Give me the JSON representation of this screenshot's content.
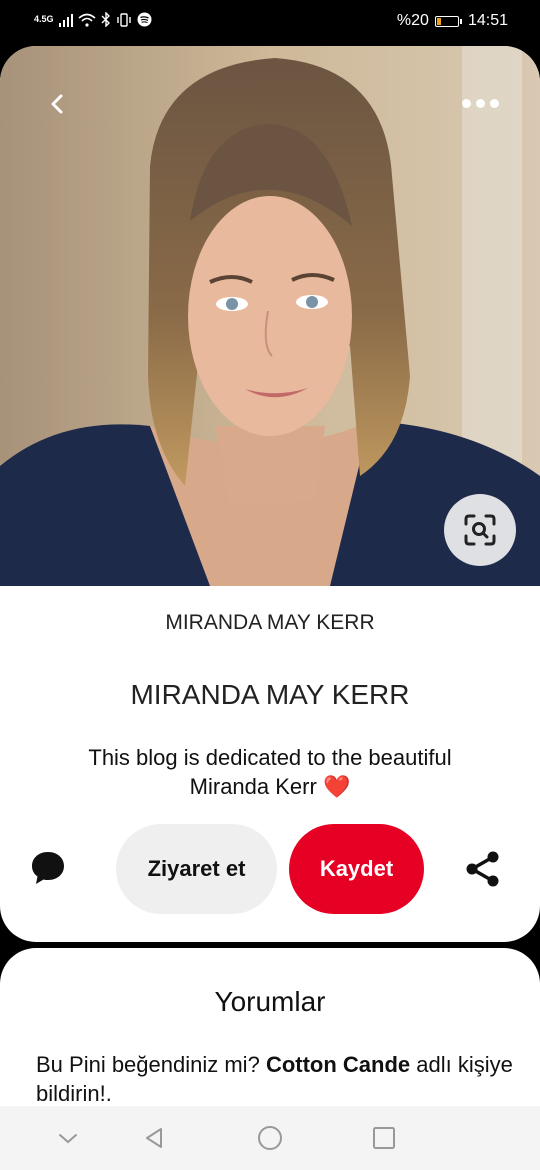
{
  "status_bar": {
    "network_label": "4.5G",
    "battery_text": "%20",
    "battery_level": 0.2,
    "time": "14:51",
    "icons": [
      "signal-icon",
      "wifi-icon",
      "bluetooth-icon",
      "vibrate-icon",
      "spotify-icon",
      "battery-icon"
    ]
  },
  "pin": {
    "image_subject": "photo-of-woman",
    "back_icon": "back-icon",
    "more_icon": "more-icon",
    "visual_search_icon": "visual-search-icon",
    "source_name": "MIRANDA MAY KERR",
    "title": "MIRANDA MAY KERR",
    "description": "This blog is dedicated to the beautiful Miranda Kerr",
    "description_emoji": "❤️"
  },
  "actions": {
    "comment_icon": "comment-icon",
    "visit_label": "Ziyaret et",
    "save_label": "Kaydet",
    "share_icon": "share-icon",
    "save_color": "#e60023"
  },
  "comments": {
    "title": "Yorumlar",
    "prompt_prefix": "Bu Pini beğendiniz mi?",
    "prompt_name": "Cotton Cande",
    "prompt_suffix": "adlı kişiye bildirin!."
  },
  "nav_bar": {
    "icons": [
      "collapse-icon",
      "back-nav-icon",
      "home-nav-icon",
      "recents-nav-icon"
    ]
  }
}
